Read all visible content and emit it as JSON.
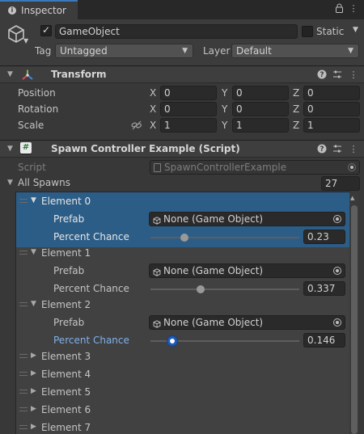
{
  "tab": {
    "label": "Inspector"
  },
  "header": {
    "name": "GameObject",
    "active_checked": true,
    "static_label": "Static",
    "tag_label": "Tag",
    "tag_value": "Untagged",
    "layer_label": "Layer",
    "layer_value": "Default"
  },
  "transform": {
    "title": "Transform",
    "rows": [
      {
        "label": "Position",
        "x": "0",
        "y": "0",
        "z": "0"
      },
      {
        "label": "Rotation",
        "x": "0",
        "y": "0",
        "z": "0"
      },
      {
        "label": "Scale",
        "x": "1",
        "y": "1",
        "z": "1"
      }
    ],
    "axes": {
      "x": "X",
      "y": "Y",
      "z": "Z"
    }
  },
  "script_comp": {
    "title": "Spawn Controller Example (Script)",
    "script_label": "Script",
    "script_value": "SpawnControllerExample",
    "list_label": "All Spawns",
    "list_count": "27",
    "prefab_label": "Prefab",
    "chance_label": "Percent Chance",
    "prefab_value": "None (Game Object)",
    "elements": [
      {
        "name": "Element 0",
        "expanded": true,
        "chance": "0.23",
        "slider": 0.23
      },
      {
        "name": "Element 1",
        "expanded": true,
        "chance": "0.337",
        "slider": 0.337
      },
      {
        "name": "Element 2",
        "expanded": true,
        "chance": "0.146",
        "slider": 0.146
      },
      {
        "name": "Element 3",
        "expanded": false
      },
      {
        "name": "Element 4",
        "expanded": false
      },
      {
        "name": "Element 5",
        "expanded": false
      },
      {
        "name": "Element 6",
        "expanded": false
      },
      {
        "name": "Element 7",
        "expanded": false
      }
    ]
  },
  "colors": {
    "accent": "#3a79bb",
    "selection": "#2c5d87",
    "focused_label": "#7fb1e8"
  }
}
